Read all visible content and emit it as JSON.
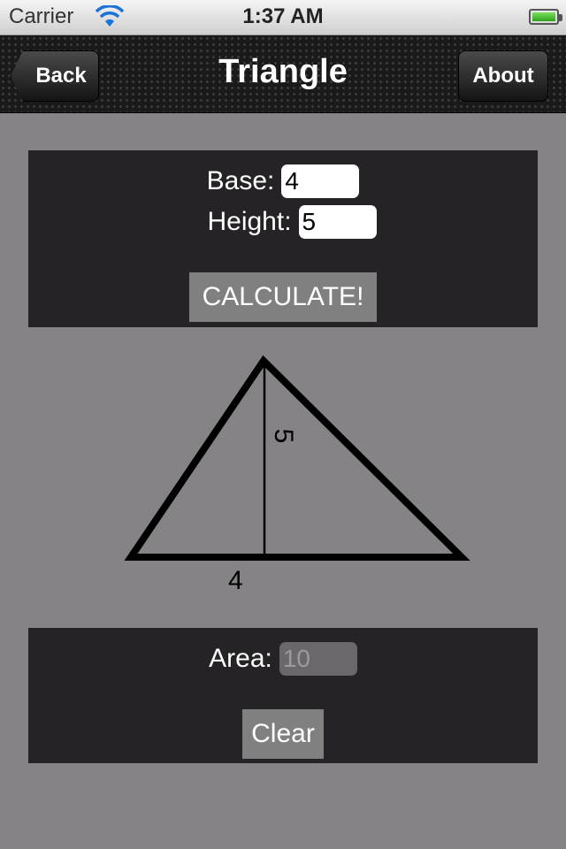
{
  "status_bar": {
    "carrier": "Carrier",
    "time": "1:37 AM"
  },
  "nav": {
    "title": "Triangle",
    "back_label": "Back",
    "about_label": "About"
  },
  "inputs": {
    "base_label": "Base:",
    "base_value": "4",
    "height_label": "Height:",
    "height_value": "5",
    "calculate_label": "CALCULATE!"
  },
  "figure": {
    "base_label": "4",
    "height_label": "5"
  },
  "result": {
    "area_label": "Area:",
    "area_value": "10",
    "clear_label": "Clear"
  },
  "icons": [
    "wifi-icon",
    "battery-icon",
    "back-chevron"
  ],
  "colors": {
    "background": "#858385",
    "panel": "#252325",
    "button": "#818081"
  }
}
